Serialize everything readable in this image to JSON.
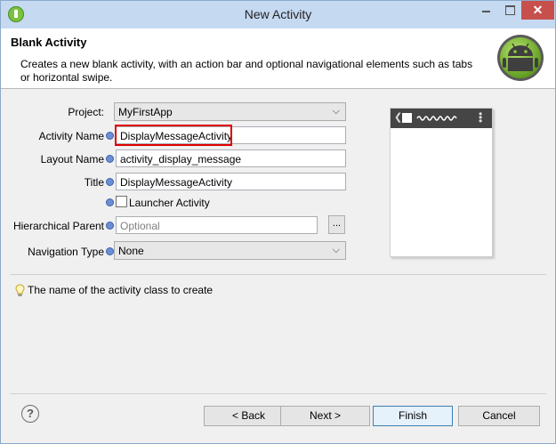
{
  "window": {
    "title": "New Activity",
    "close_glyph": "✕"
  },
  "header": {
    "title": "Blank Activity",
    "description": "Creates a new blank activity, with an action bar and optional navigational elements such as tabs or horizontal swipe.",
    "logo_icon": "android-logo-icon"
  },
  "form": {
    "project": {
      "label": "Project:",
      "value": "MyFirstApp"
    },
    "activity_name": {
      "label": "Activity Name",
      "value": "DisplayMessageActivity"
    },
    "layout_name": {
      "label": "Layout Name",
      "value": "activity_display_message"
    },
    "title": {
      "label": "Title",
      "value": "DisplayMessageActivity"
    },
    "launcher": {
      "label": "Launcher Activity",
      "checked": false
    },
    "hierarchical_parent": {
      "label": "Hierarchical Parent",
      "placeholder": "Optional",
      "browse_label": "..."
    },
    "navigation_type": {
      "label": "Navigation Type",
      "value": "None"
    }
  },
  "hint": {
    "text": "The name of the activity class to create"
  },
  "footer": {
    "help_glyph": "?",
    "back": "< Back",
    "next": "Next >",
    "finish": "Finish",
    "cancel": "Cancel"
  },
  "colors": {
    "title_bar": "#c5d9f1",
    "close_button": "#c7504c",
    "highlight": "#e00000",
    "android_green": "#8dc63f"
  }
}
